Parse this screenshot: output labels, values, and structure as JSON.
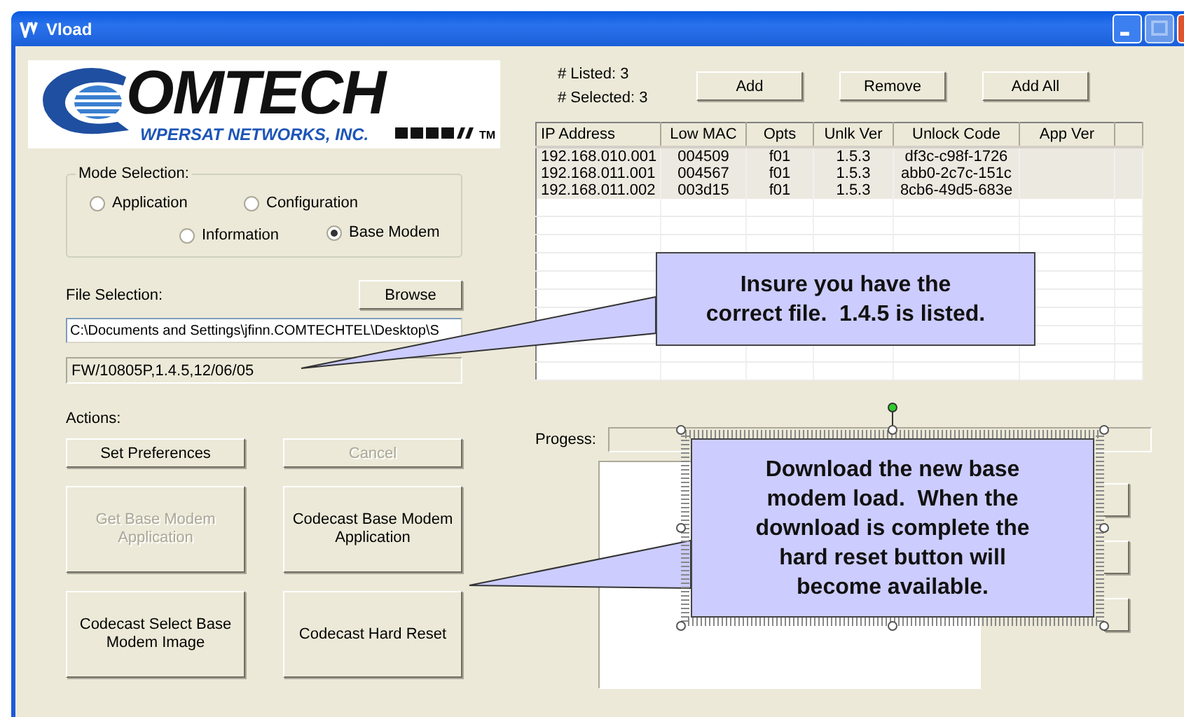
{
  "window": {
    "title": "Vload"
  },
  "logo": {
    "wordmark": "OMTECH",
    "subtitle": "WPERSAT NETWORKS, INC.",
    "trademark": "TM"
  },
  "mode_selection": {
    "label": "Mode Selection:",
    "options": [
      {
        "label": "Application",
        "selected": false
      },
      {
        "label": "Configuration",
        "selected": false
      },
      {
        "label": "Information",
        "selected": false
      },
      {
        "label": "Base Modem",
        "selected": true
      }
    ]
  },
  "file_selection": {
    "label": "File Selection:",
    "browse_button": "Browse",
    "path": "C:\\Documents and Settings\\jfinn.COMTECHTEL\\Desktop\\S",
    "firmware": "FW/10805P,1.4.5,12/06/05"
  },
  "actions": {
    "label": "Actions:",
    "buttons": [
      {
        "label": "Set Preferences",
        "disabled": false
      },
      {
        "label": "Cancel",
        "disabled": true
      },
      {
        "label": "Get Base Modem Application",
        "disabled": true
      },
      {
        "label": "Codecast Base Modem Application",
        "disabled": false
      },
      {
        "label": "Codecast Select Base Modem Image",
        "disabled": false
      },
      {
        "label": "Codecast Hard Reset",
        "disabled": false
      }
    ]
  },
  "counts": {
    "listed": "# Listed: 3",
    "selected": "# Selected: 3"
  },
  "list_buttons": [
    "Add",
    "Remove",
    "Add All"
  ],
  "table": {
    "columns": [
      "IP Address",
      "Low MAC",
      "Opts",
      "Unlk Ver",
      "Unlock Code",
      "App Ver"
    ],
    "rows": [
      {
        "cells": [
          "192.168.010.001",
          "004509",
          "f01",
          "1.5.3",
          "df3c-c98f-1726"
        ],
        "selected": true
      },
      {
        "cells": [
          "192.168.011.001",
          "004567",
          "f01",
          "1.5.3",
          "abb0-2c7c-151c"
        ],
        "selected": true
      },
      {
        "cells": [
          "192.168.011.002",
          "003d15",
          "f01",
          "1.5.3",
          "8cb6-49d5-683e"
        ],
        "selected": true
      }
    ]
  },
  "progress": {
    "label": "Progess:",
    "level": 0
  },
  "callouts": [
    {
      "text": "Insure you have the correct file.  1.4.5 is listed.",
      "selected": false
    },
    {
      "text": "Download the new base modem load.  When the download is complete the hard reset button will become available.",
      "selected": true
    }
  ]
}
